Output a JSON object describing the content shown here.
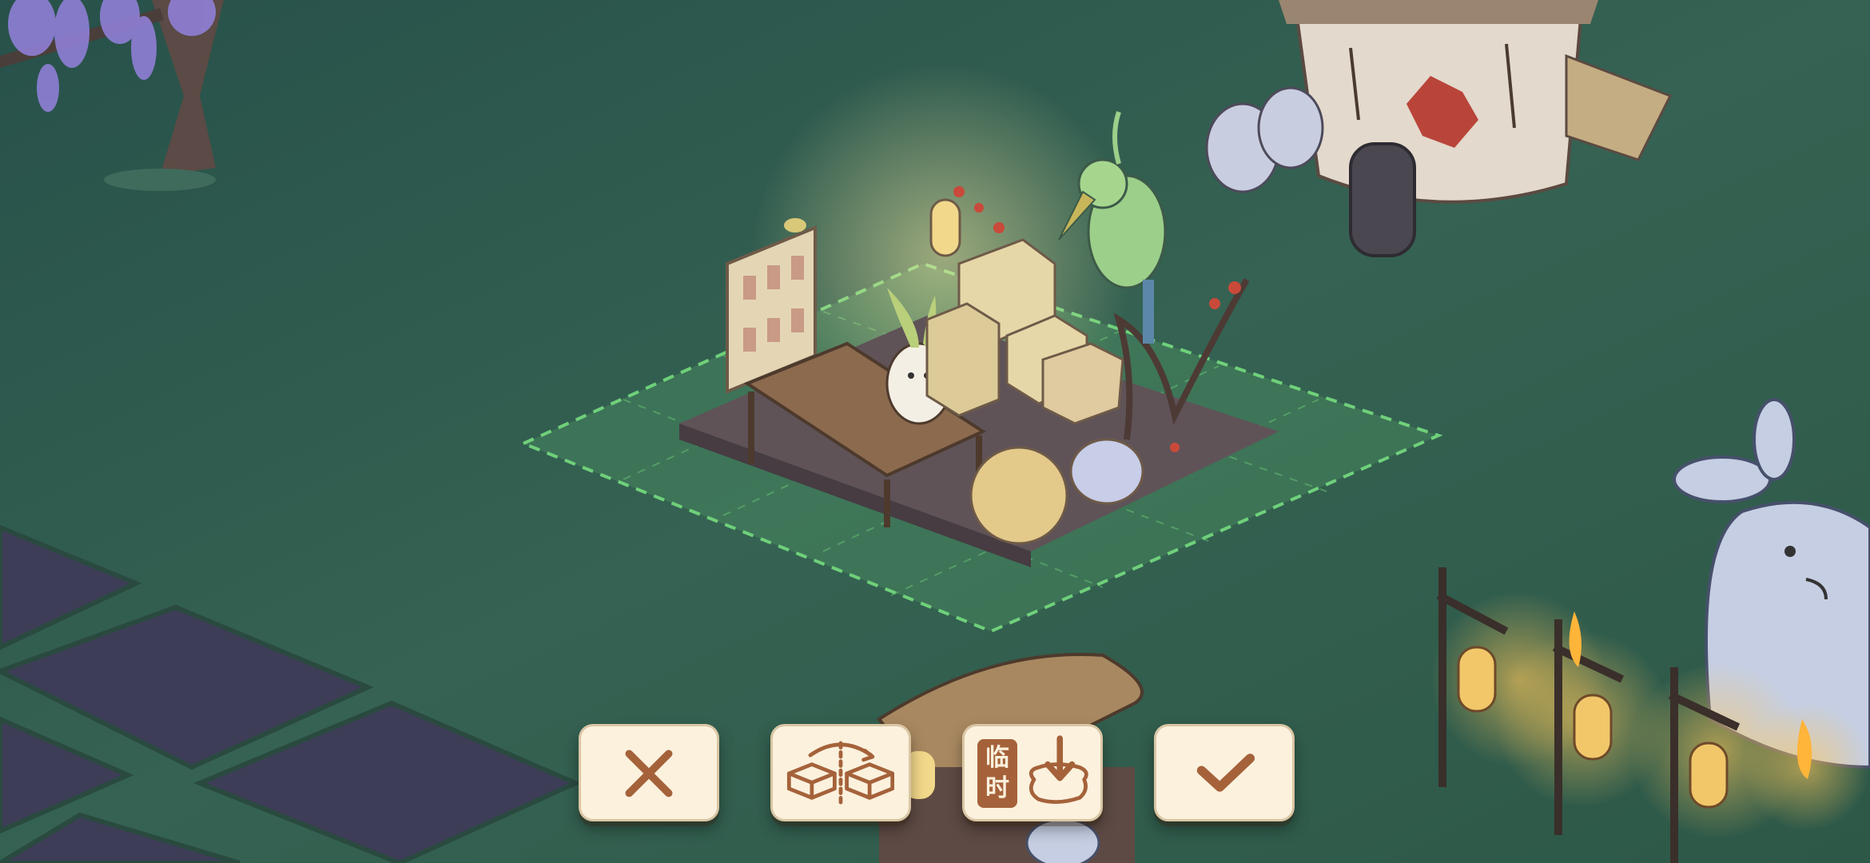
{
  "scene": {
    "description_name": "night-village-placement-view"
  },
  "toolbar": {
    "cancel": {
      "icon": "close-x-icon"
    },
    "rotate": {
      "icon": "flip-building-icon"
    },
    "store": {
      "icon": "store-to-bag-icon",
      "tag_line1": "临",
      "tag_line2": "时"
    },
    "confirm": {
      "icon": "checkmark-icon"
    }
  },
  "colors": {
    "button_bg": "#fbf1dd",
    "icon_brown": "#a5623a",
    "grass": "#2f5a4c",
    "placement_grid": "#6fd07a"
  }
}
